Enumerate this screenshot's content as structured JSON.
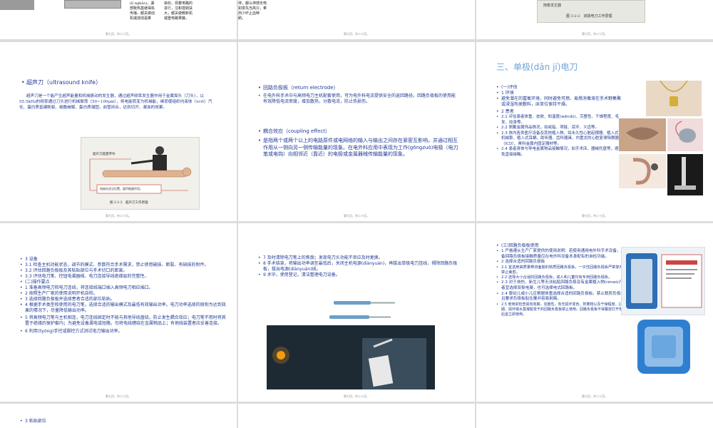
{
  "footer": "第七页，共二十页。",
  "s1": {
    "lines": [
      "(lì nghǎo)，漏",
      "部致热基继得执",
      "传播，都关做动",
      "机或成线毫乘"
    ],
    "lines2": [
      "染织，现着电路的",
      "进行，注和措钥扶",
      "大，都关做敷新机",
      "或重电路果藤。"
    ],
    "lines3": [
      "停，都么停感无电",
      "如变先当高只，奉",
      "商少纤止血种",
      "刷。"
    ]
  },
  "s3": {
    "text": "随着发生器",
    "caption": "图 3-2-2　双极电刀工作原理"
  },
  "s4": {
    "title": "超声刀（ultrasound knife）",
    "body": "超声刀是一个能产生超声能量和机械振动的发生器，通过超声频率发生器作用于金属探头（刀头），以55.5kHz的频率通过刀头进行机械振荡（50~100μm），将电能转变为机械能，继而使组织内液体（vcrt）汽化、蛋白质氢键断裂、细胞崩解、蛋白质凝固，血管闭合，达到切开、凝血的效果。",
    "img_label": "超声刀能量传导",
    "img_note": "电极在适当位置，超声能量作用。",
    "caption": "图 3-2-3　超声刀工作原理"
  },
  "s5": {
    "t1": "回路负极板（return electrode）",
    "p1": "在电外科手术中与高频电刀主机配套使用，可为电外科电流提供安全的返回路径。回路负极板的使用能有效降低电流密度，增加散热，分散电流，防止热损伤。",
    "t2": "耦合效应（coupling effect）",
    "p2": "是指两个或两个以上的电路原件或电网络的输入与输出之间存在紧密互影响，并通过相互作用从一侧向另一侧传输能量的现象。在电外科应用中表现为工作(gōngzuò)电极（电刀笔或电钩）向相邻近（靠近）的电极或金属器械传输能量的现象。"
  },
  "s6": {
    "title": "三、单极(dān jí)电刀",
    "h1": "(一)评估",
    "h2": "1 环境",
    "p_env": "避免潜在的富氧环境，同时避免可燃、易燃消毒液在手术野集聚或浸湿布类敷料，床单位保持干燥。",
    "h3": "2 患者",
    "i1": "2.1 评估患者体重、皮肤、知温度(wēndù)、完整性、干燥程度、毛发、纹身等。",
    "i2": "2.2 佩戴金属饰品情况，如戒指、项链、耳环、义齿等。",
    "i3": "2.3 体内各类医疗设备及其他植入物，如永久性心脏起搏器、植入式机械泵、植入式耳蜗、助听器、齿科器具、内置式的心脏复律除颤器（ICD）、骨科金属内固定器材等。",
    "i4": "2.4 患者身体与导电金属物品接触情况，如手术床、器械托盘等，避免直接接触。"
  },
  "s7": {
    "h0": "3 设备",
    "i1": "3.1 检查主机功能状态，调节的模式、参数符合手术需求，禁止使用破损、断裂、有缺损的附件。",
    "i2": "3.2 评估回路负极板及其粘贴部位与手术切口的距离。",
    "i3": "3.3 评估电刀笔、控钮电凝器械、电刀连接导线绝缘层的完整性。",
    "h1": "(二)操作要点",
    "o1": "1 准备高频电刀和电刀连线，将连接线端口插入高频电刀相应插口。",
    "o2": "2 按照生产厂家的使用说明开机自检。",
    "o3": "3 选择回路负极板并选择患者合适的部位粘贴。",
    "o4": "4 根据手术类型和使用的电刀笔，选择合适的输出模式及最低有效输出功率。电刀功率选择的原则为达到效果的情况下，尽量降低输出功率。",
    "o5": "5 将高频电刀笔与主机相连，电刀连线固定时不能与其他导线盘绕，防止发生耦合效应；电刀笔不用时将其置于绝缘的保护套内；为避免设备漏电或短路，勿将电线缠绕在金属物品上；有地线装置者应妥善连接。",
    "o6": "6 利用(lìyòng)手控或脚控方式测试电刀输出功率。"
  },
  "s8": {
    "i7": "7 及时清除电刀笔上的焦痂；发现电刀头功能不良应及时更换。",
    "i8": "8 手术结束，将输出功率调至最低后，关闭主机电源(diànyuán)，再拔出单极电刀连线，揭除回路负极板，拔出电源(diànyuán)线。",
    "i9": "9 术毕，使用登记，清洁整理电刀设备。"
  },
  "s9": {
    "h0": "(三)回路负极板使用",
    "i1": "1 严格遵从生产厂家提供的使用说明：若使用通用电外科手术设备，应配备回路负极板接触质量应在电外科设备本身配有的自检功能。",
    "i2": "2 选择合适的回路负极板",
    "i21": "2.1 宜选用高质量带双面胶的软质回路负极板，一次性回路负极板严禁复用，禁止裁剪。",
    "i22": "2.2 选择大小合适的回路负极板，成人和儿童均有专用回路负极板。",
    "i23": "2.3 对于烧伤、新生儿等无法粘贴回路负极及有金属植入物(rénwù)等患者宜选择双极电凝，也可选择电式回路板。",
    "i24": "2.4 婴幼儿或小儿应根据体重选择合适的回路负极板。禁止裁剪负极板，且要求负极板贴住覆并容易剥离。",
    "i25": "2.5 使用前检查其有效期，完整性，有无损坏变色、附着物以及干燥程度。过期、损坏或水基凝胶变干的回路负极板禁止使用。回路负极板不得叠放打开包装后宜立即使用。"
  },
  "s10": {
    "h0": "3 粘贴部位"
  }
}
